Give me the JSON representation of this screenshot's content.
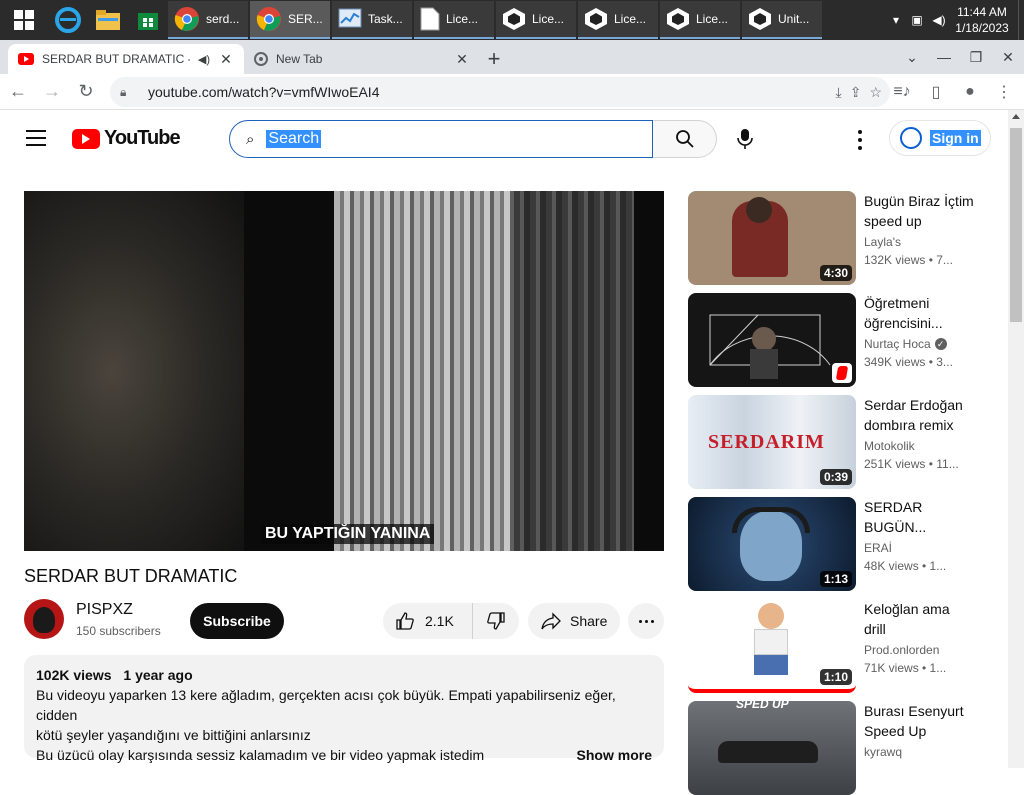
{
  "taskbar": {
    "items": [
      {
        "label": "serd..."
      },
      {
        "label": "SER..."
      },
      {
        "label": "Task..."
      },
      {
        "label": "Lice..."
      },
      {
        "label": "Lice..."
      },
      {
        "label": "Lice..."
      },
      {
        "label": "Lice..."
      },
      {
        "label": "Unit..."
      }
    ],
    "time": "11:44 AM",
    "date": "1/18/2023"
  },
  "browser": {
    "tabs": [
      {
        "title": "SERDAR BUT DRAMATIC - Yo"
      },
      {
        "title": "New Tab"
      }
    ],
    "url": "youtube.com/watch?v=vmfWIwoEAI4"
  },
  "youtube": {
    "logo_text": "YouTube",
    "search_text": "Search",
    "signin_label": "Sign in"
  },
  "video": {
    "caption": "BU YAPTIĞIN YANINA",
    "title": "SERDAR BUT DRAMATIC",
    "channel": "PISPXZ",
    "subscribers": "150 subscribers",
    "subscribe_label": "Subscribe",
    "likes": "2.1K",
    "share_label": "Share",
    "views": "102K views",
    "age": "1 year ago",
    "description_line1": "Bu videoyu yaparken 13 kere ağladım, gerçekten acısı çok büyük. Empati yapabilirseniz eğer, cidden",
    "description_line2": "kötü şeyler yaşandığını ve bittiğini anlarsınız",
    "description_line3": "Bu üzücü olay karşısında sessiz kalamadım ve bir video yapmak istedim",
    "show_more": "Show more"
  },
  "recommendations": [
    {
      "title": "Bugün Biraz İçtim speed up",
      "channel": "Layla's",
      "stats": "132K views  • 7...",
      "duration": "4:30",
      "thumb_color": "#a38a73"
    },
    {
      "title": "Öğretmeni öğrencisini...",
      "channel": "Nurtaç Hoca",
      "verified": "✓",
      "stats": "349K views  • 3...",
      "duration": "",
      "thumb_color": "#151515"
    },
    {
      "title": "Serdar Erdoğan dombıra remix",
      "channel": "Motokolik",
      "stats": "251K views  • 11...",
      "duration": "0:39",
      "thumb_color": "#dfe6ee",
      "thumb_text": "SERDARIM"
    },
    {
      "title": "SERDAR BUGÜN...",
      "channel": "ERAİ",
      "stats": "48K views  • 1...",
      "duration": "1:13",
      "thumb_color": "#16304f"
    },
    {
      "title": "Keloğlan ama drill",
      "channel": "Prod.onlorden",
      "stats": "71K views  • 1...",
      "duration": "1:10",
      "thumb_color": "#ffffff"
    },
    {
      "title": "Burası Esenyurt Speed Up",
      "channel": "kyrawq",
      "stats": "",
      "duration": "",
      "thumb_color": "#55585c",
      "thumb_text": "SPED UP"
    }
  ]
}
